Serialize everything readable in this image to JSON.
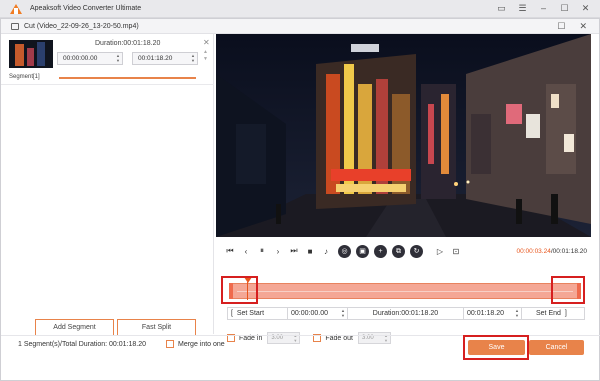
{
  "app": {
    "title": "Apeaksoft Video Converter Ultimate"
  },
  "dialog": {
    "title": "Cut (Video_22-09-26_13-20-50.mp4)"
  },
  "segment": {
    "duration_label": "Duration:00:01:18.20",
    "start": "00:00:00.00",
    "end": "00:01:18.20",
    "label": "Segment[1]"
  },
  "left_buttons": {
    "add_segment": "Add Segment",
    "fast_split": "Fast Split"
  },
  "player": {
    "current_time": "00:00:03.24",
    "total_time": "/00:01:18.20"
  },
  "trim": {
    "set_start": "Set Start",
    "start_value": "00:00:00.00",
    "duration": "Duration:00:01:18.20",
    "end_value": "00:01:18.20",
    "set_end": "Set End"
  },
  "fade": {
    "fade_in_label": "Fade in",
    "fade_in_value": "3.00",
    "fade_out_label": "Fade out",
    "fade_out_value": "3.00"
  },
  "footer": {
    "summary": "1 Segment(s)/Total Duration: 00:01:18.20",
    "merge_label": "Merge into one",
    "save": "Save",
    "cancel": "Cancel"
  },
  "colors": {
    "accent": "#e8834a",
    "highlight": "#d61f1f",
    "time_accent": "#e8551c"
  },
  "icons": [
    "logo-icon",
    "chat-icon",
    "menu-icon",
    "minimize-icon",
    "maximize-icon",
    "close-icon",
    "film-icon",
    "skip-start-icon",
    "prev-frame-icon",
    "pause-icon",
    "next-frame-icon",
    "skip-end-icon",
    "stop-icon",
    "volume-icon",
    "crop-icon",
    "rotate-icon",
    "add-icon",
    "copy-icon",
    "refresh-icon",
    "clip-in-icon",
    "clip-out-icon"
  ]
}
